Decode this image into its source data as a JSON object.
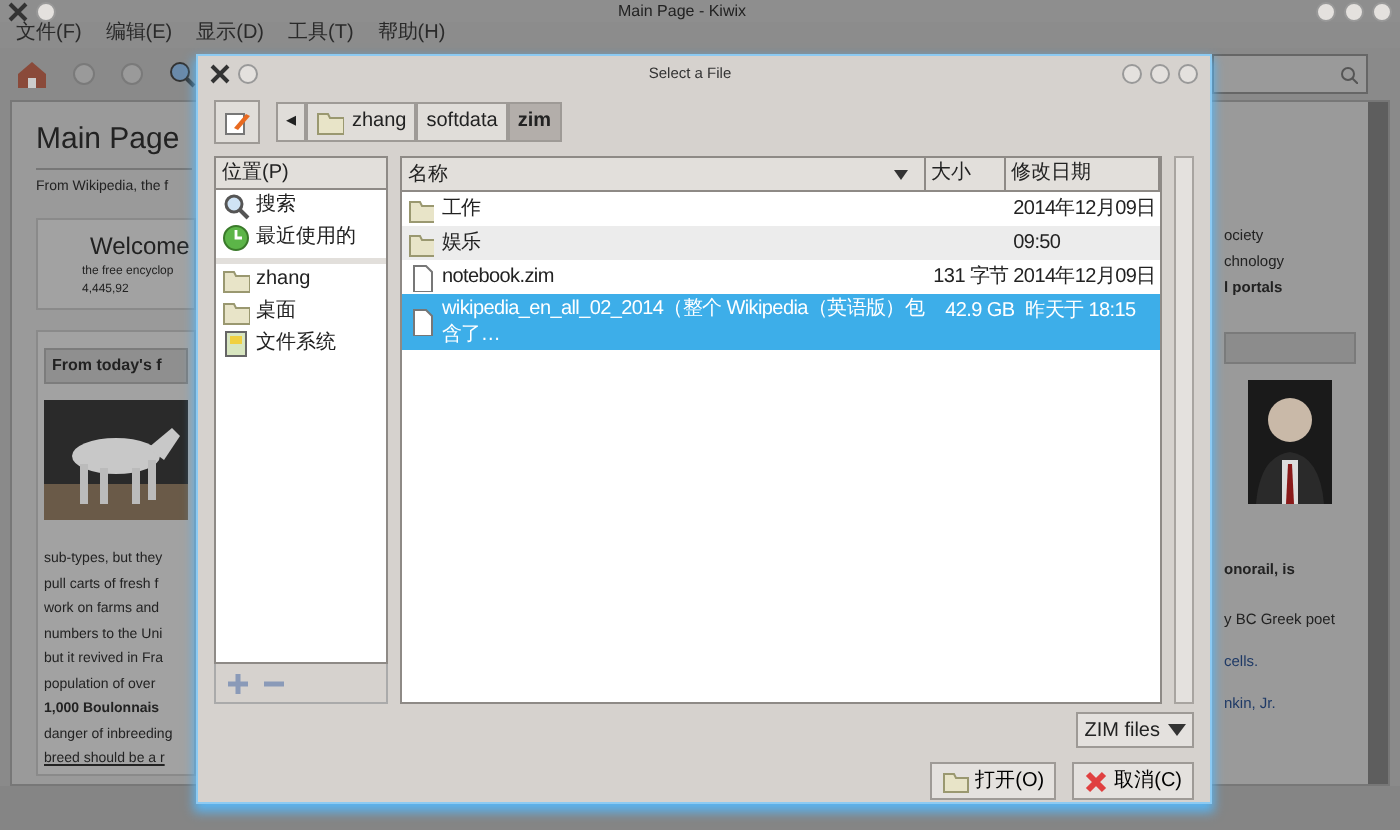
{
  "background_window": {
    "title": "Main Page - Kiwix",
    "menu": [
      "文件(F)",
      "编辑(E)",
      "显示(D)",
      "工具(T)",
      "帮助(H)"
    ],
    "article": {
      "heading": "Main Page",
      "subtitle": "From Wikipedia, the f",
      "welcome_title": "Welcome",
      "welcome_lines": [
        "the free encyclop",
        "4,445,92"
      ],
      "featured_title": "From today's f",
      "paragraph_lines": [
        {
          "text": "sub-types, but they",
          "kind": "plain"
        },
        {
          "text": "pull carts of fresh f",
          "kind": "plain"
        },
        {
          "text": "work on farms and",
          "kind": "plain"
        },
        {
          "text": "numbers to the Uni",
          "kind": "plain"
        },
        {
          "text": "but it revived in Fra",
          "kind": "plain"
        },
        {
          "text": "population of over",
          "kind": "plain"
        },
        {
          "text": "1,000 Boulonnais",
          "kind": "bold"
        },
        {
          "text": "danger of inbreeding",
          "kind": "plain"
        },
        {
          "text": "breed should be a r",
          "kind": "link"
        }
      ]
    },
    "portal_lines": [
      {
        "text": "ociety",
        "kind": "plain"
      },
      {
        "text": "chnology",
        "kind": "plain"
      },
      {
        "text": "l portals",
        "kind": "bold"
      }
    ],
    "news_lines": [
      {
        "text": "onorail, is",
        "kind": "bold"
      },
      {
        "text": "y BC Greek poet",
        "kind": "plain"
      },
      {
        "text": "cells.",
        "kind": "link"
      },
      {
        "text": "nkin, Jr.",
        "kind": "link"
      }
    ]
  },
  "dialog": {
    "title": "Select a File",
    "path_scroll_button": "◂",
    "path": [
      {
        "label": "zhang",
        "folder": true,
        "selected": false
      },
      {
        "label": "softdata",
        "folder": false,
        "selected": false
      },
      {
        "label": "zim",
        "folder": false,
        "selected": true
      }
    ],
    "places_header": "位置(P)",
    "places": [
      {
        "label": "搜索",
        "kind": "search"
      },
      {
        "label": "最近使用的",
        "kind": "recent"
      }
    ],
    "bookmarks": [
      {
        "label": "zhang",
        "kind": "folder"
      },
      {
        "label": "桌面",
        "kind": "folder"
      },
      {
        "label": "文件系统",
        "kind": "drive"
      }
    ],
    "columns": [
      "名称",
      "大小",
      "修改日期"
    ],
    "files": [
      {
        "name": "工作",
        "modified": "2014年12月09日",
        "kind": "folder",
        "selected": false
      },
      {
        "name": "娱乐",
        "modified": "09:50",
        "kind": "folder",
        "selected": false
      },
      {
        "name": "notebook.zim",
        "size": "131 字节",
        "modified": "2014年12月09日",
        "kind": "file",
        "selected": false
      },
      {
        "name": "wikipedia_en_all_02_2014（整个 Wikipedia（英语版）包含了…",
        "size": "42.9 GB",
        "modified": "昨天于 18:15",
        "kind": "file",
        "selected": true
      }
    ],
    "filter": "ZIM files",
    "buttons": [
      {
        "label": "打开(O)",
        "kind": "open"
      },
      {
        "label": "取消(C)",
        "kind": "cancel"
      }
    ]
  }
}
